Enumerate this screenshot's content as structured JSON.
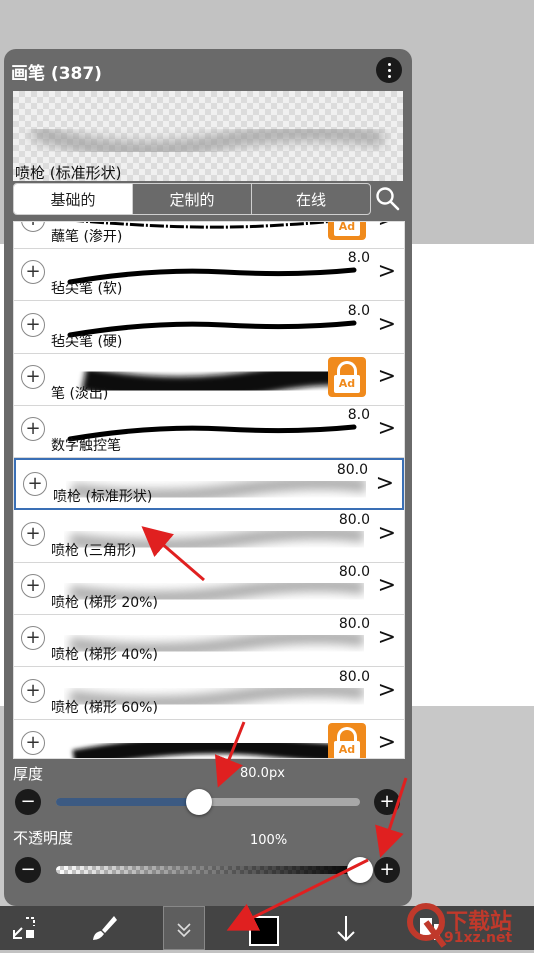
{
  "panel": {
    "title": "画笔 (387)",
    "preview_name": "喷枪 (标准形状)",
    "tabs": [
      {
        "label": "基础的",
        "active": true
      },
      {
        "label": "定制的",
        "active": false
      },
      {
        "label": "在线",
        "active": false
      }
    ],
    "brushes": [
      {
        "name": "蘸笔 (渗开)",
        "size": "",
        "locked": true,
        "style": "thin-dash"
      },
      {
        "name": "毡尖笔 (软)",
        "size": "8.0",
        "locked": false,
        "style": "bold-line"
      },
      {
        "name": "毡尖笔 (硬)",
        "size": "8.0",
        "locked": false,
        "style": "bold-line"
      },
      {
        "name": "笔 (淡出)",
        "size": "",
        "locked": true,
        "style": "thick-blur"
      },
      {
        "name": "数字触控笔",
        "size": "8.0",
        "locked": false,
        "style": "bold-line"
      },
      {
        "name": "喷枪 (标准形状)",
        "size": "80.0",
        "locked": false,
        "style": "airbrush",
        "selected": true
      },
      {
        "name": "喷枪 (三角形)",
        "size": "80.0",
        "locked": false,
        "style": "airbrush"
      },
      {
        "name": "喷枪 (梯形 20%)",
        "size": "80.0",
        "locked": false,
        "style": "airbrush"
      },
      {
        "name": "喷枪 (梯形 40%)",
        "size": "80.0",
        "locked": false,
        "style": "airbrush"
      },
      {
        "name": "喷枪 (梯形 60%)",
        "size": "80.0",
        "locked": false,
        "style": "airbrush"
      },
      {
        "name": "",
        "size": "",
        "locked": true,
        "style": "rough"
      }
    ],
    "lock_label": "Ad",
    "thickness": {
      "label": "厚度",
      "value_text": "80.0px",
      "fraction": 0.47
    },
    "opacity": {
      "label": "不透明度",
      "value_text": "100%",
      "fraction": 1.0
    }
  },
  "toolbar": {
    "icons": [
      "transform-icon",
      "brush-icon",
      "collapse-icon",
      "color-swatch",
      "move-down-icon",
      "layers-icon"
    ]
  },
  "watermark": {
    "text": "下载站",
    "url": "91xz.net"
  },
  "colors": {
    "panel": "#6a6a6a",
    "accent": "#3a6fb5",
    "track_fill": "#3c5a82",
    "lock": "#f08a1c",
    "arrow": "#e02020"
  }
}
